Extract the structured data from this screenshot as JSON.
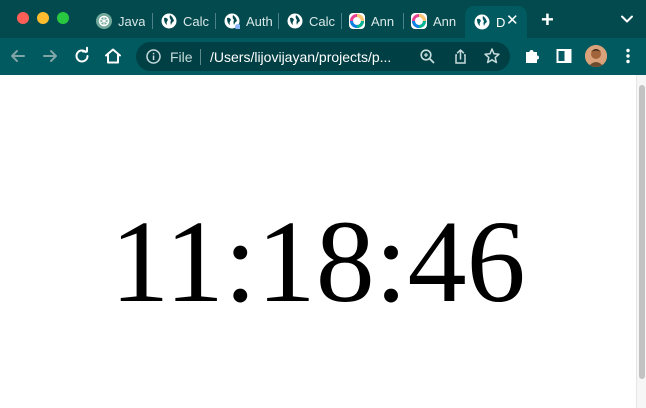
{
  "browser": {
    "tabs": [
      {
        "label": "Java",
        "icon": "chatgpt-icon"
      },
      {
        "label": "Calc",
        "icon": "globe-icon"
      },
      {
        "label": "Auth",
        "icon": "globe-icon"
      },
      {
        "label": "Calc",
        "icon": "globe-icon"
      },
      {
        "label": "Ann",
        "icon": "color-ring-icon"
      },
      {
        "label": "Ann",
        "icon": "color-ring-icon"
      },
      {
        "label": "D",
        "icon": "globe-icon",
        "active": true
      }
    ],
    "new_tab_symbol": "+",
    "close_symbol": "✕",
    "address": {
      "scheme_label": "File",
      "url": "/Users/lijovijayan/projects/p..."
    },
    "colors": {
      "tabstrip": "#034a4e",
      "toolbar": "#005a5f",
      "omnibox": "#003f44"
    }
  },
  "page": {
    "clock_text": "11:18:46"
  }
}
